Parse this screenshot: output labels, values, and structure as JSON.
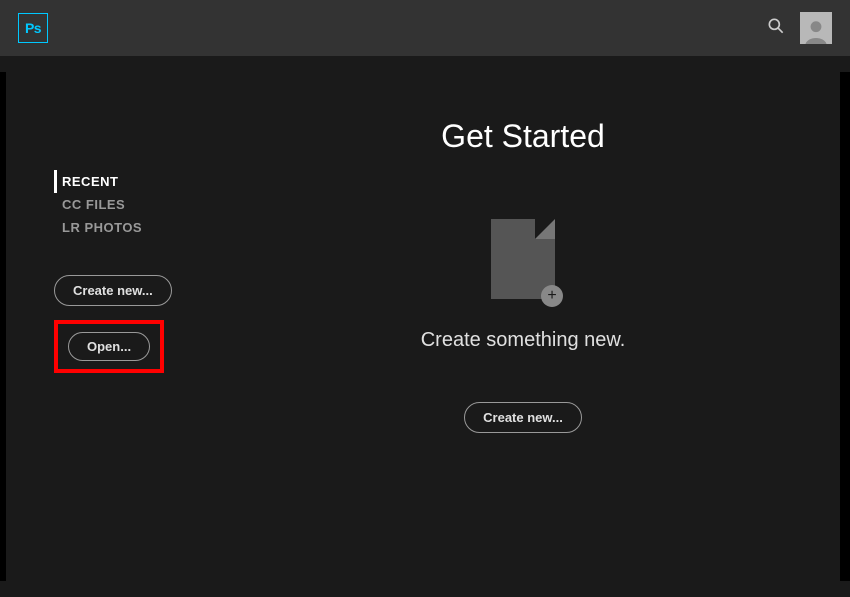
{
  "app": {
    "logo_text": "Ps"
  },
  "sidebar": {
    "items": [
      {
        "label": "RECENT",
        "active": true
      },
      {
        "label": "CC FILES",
        "active": false
      },
      {
        "label": "LR PHOTOS",
        "active": false
      }
    ],
    "create_label": "Create new...",
    "open_label": "Open..."
  },
  "content": {
    "heading": "Get Started",
    "subheading": "Create something new.",
    "create_label": "Create new...",
    "plus_symbol": "+"
  }
}
